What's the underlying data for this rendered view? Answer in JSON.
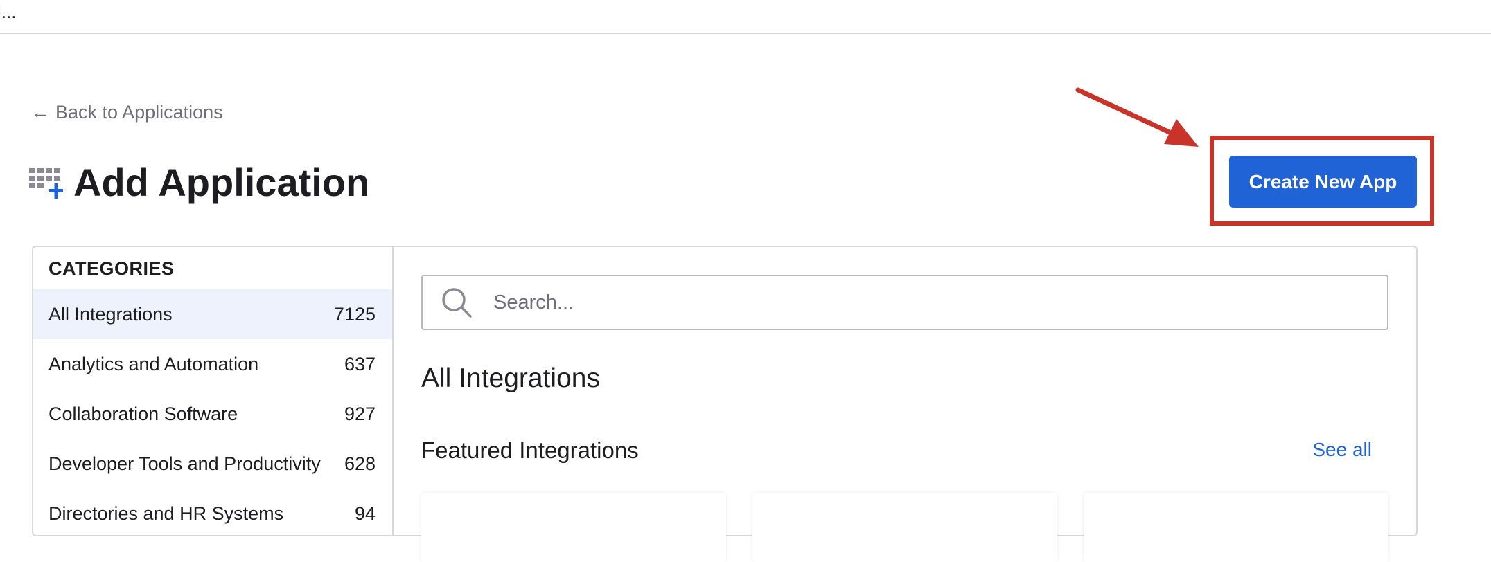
{
  "topbar": {
    "truncated_text": "l..."
  },
  "back_link": {
    "arrow": "←",
    "label": "Back to Applications"
  },
  "page": {
    "title": "Add Application",
    "title_icon": "apps-add-icon"
  },
  "actions": {
    "create_new_app_label": "Create New App"
  },
  "colors": {
    "accent": "#1f63d6",
    "annotation": "#c8342a",
    "active_row": "#eef2fc"
  },
  "sidebar": {
    "heading": "CATEGORIES",
    "items": [
      {
        "label": "All Integrations",
        "count": "7125",
        "active": true
      },
      {
        "label": "Analytics and Automation",
        "count": "637"
      },
      {
        "label": "Collaboration Software",
        "count": "927"
      },
      {
        "label": "Developer Tools and Productivity",
        "count": "628"
      },
      {
        "label": "Directories and HR Systems",
        "count": "94"
      }
    ]
  },
  "search": {
    "placeholder": "Search..."
  },
  "main": {
    "section_title": "All Integrations",
    "featured_title": "Featured Integrations",
    "see_all_label": "See all"
  }
}
